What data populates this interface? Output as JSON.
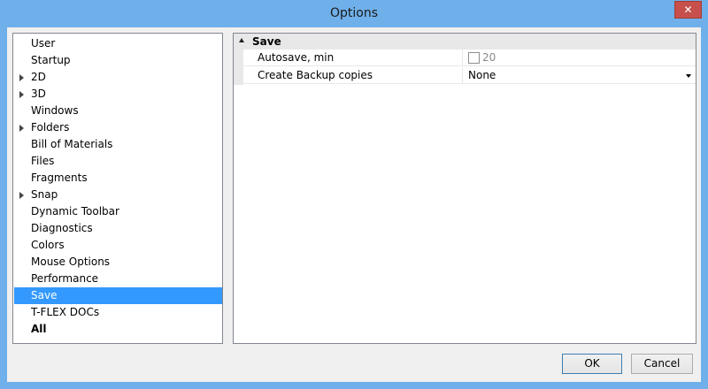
{
  "window": {
    "title": "Options",
    "close_glyph": "✕"
  },
  "tree": {
    "items": [
      {
        "label": "User",
        "expandable": false
      },
      {
        "label": "Startup",
        "expandable": false
      },
      {
        "label": "2D",
        "expandable": true
      },
      {
        "label": "3D",
        "expandable": true
      },
      {
        "label": "Windows",
        "expandable": false
      },
      {
        "label": "Folders",
        "expandable": true
      },
      {
        "label": "Bill of Materials",
        "expandable": false
      },
      {
        "label": "Files",
        "expandable": false
      },
      {
        "label": "Fragments",
        "expandable": false
      },
      {
        "label": "Snap",
        "expandable": true
      },
      {
        "label": "Dynamic Toolbar",
        "expandable": false
      },
      {
        "label": "Diagnostics",
        "expandable": false
      },
      {
        "label": "Colors",
        "expandable": false
      },
      {
        "label": "Mouse Options",
        "expandable": false
      },
      {
        "label": "Performance",
        "expandable": false
      },
      {
        "label": "Save",
        "expandable": false,
        "selected": true
      },
      {
        "label": "T-FLEX DOCs",
        "expandable": false
      },
      {
        "label": "All",
        "expandable": false,
        "bold": true
      }
    ]
  },
  "properties": {
    "category": "Save",
    "rows": [
      {
        "name": "Autosave, min",
        "value": "20",
        "checked": false
      },
      {
        "name": "Create Backup copies",
        "value": "None"
      }
    ]
  },
  "buttons": {
    "ok": "OK",
    "cancel": "Cancel"
  },
  "colors": {
    "titlebar": "#6fb0ea",
    "selection": "#3399ff"
  }
}
